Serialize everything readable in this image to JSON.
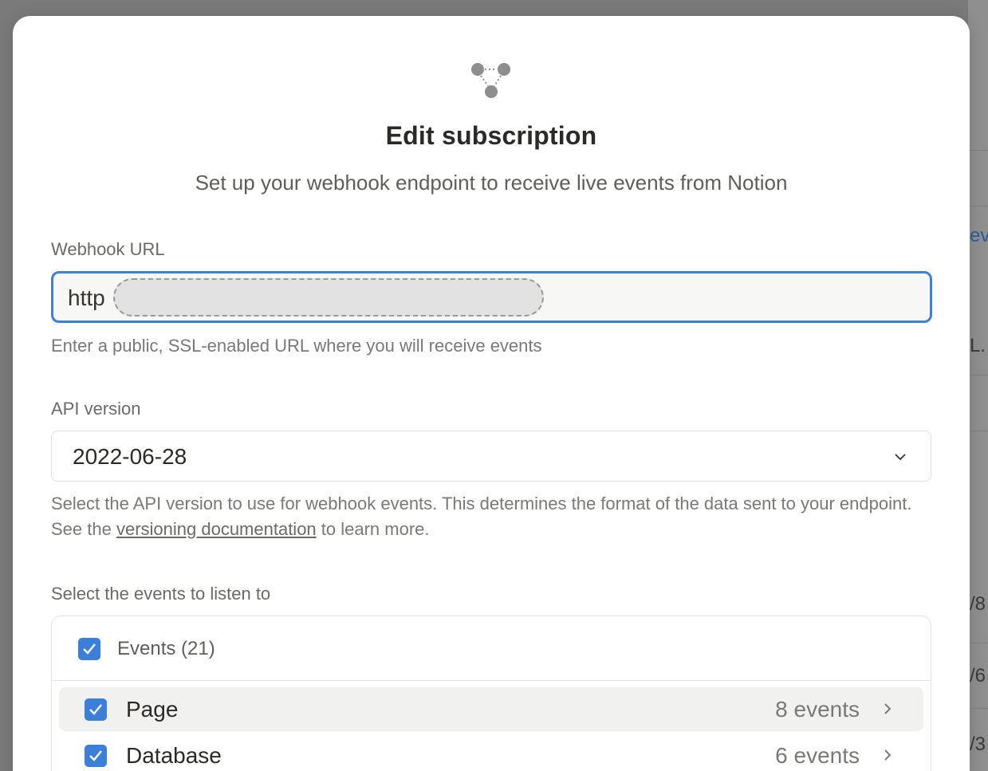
{
  "modal": {
    "title": "Edit subscription",
    "subtitle": "Set up your webhook endpoint to receive live events from Notion"
  },
  "webhook": {
    "label": "Webhook URL",
    "value_prefix": "http",
    "help": "Enter a public, SSL-enabled URL where you will receive events"
  },
  "api_version": {
    "label": "API version",
    "selected": "2022-06-28",
    "help_before": "Select the API version to use for webhook events. This determines the format of the data sent to your endpoint. See the ",
    "help_link": "versioning documentation",
    "help_after": " to learn more."
  },
  "events": {
    "label": "Select the events to listen to",
    "header": "Events (21)",
    "header_checked": true,
    "items": [
      {
        "label": "Page",
        "count": "8 events",
        "checked": true
      },
      {
        "label": "Database",
        "count": "6 events",
        "checked": true
      }
    ]
  },
  "colors": {
    "accent": "#3b7fd8",
    "focus_border": "#3f7fd6"
  },
  "icons": {
    "logo": "webhook-nodes-icon",
    "select": "chevron-down-icon",
    "row": "chevron-right-icon",
    "check": "checkmark-icon"
  },
  "background": {
    "fragments": [
      "ev",
      "L.",
      "/8",
      "/6",
      "/3"
    ]
  }
}
